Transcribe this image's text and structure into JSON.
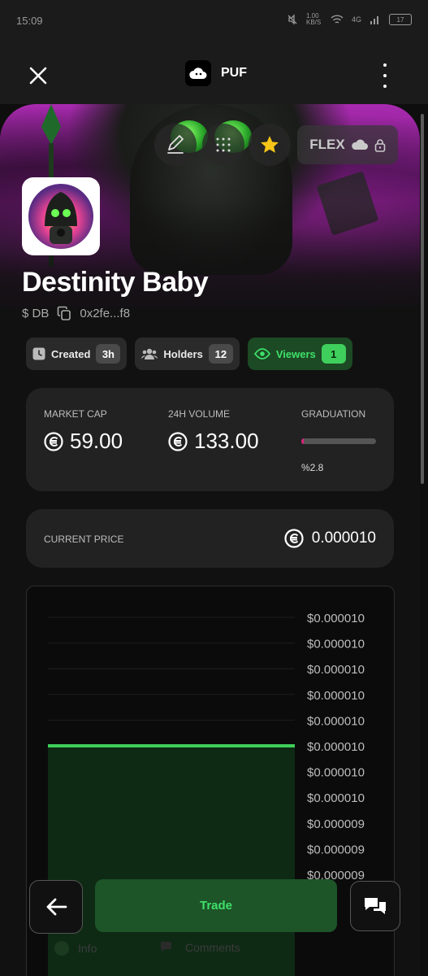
{
  "status": {
    "time": "15:09",
    "net_speed": "1.00 KB/S",
    "network": "4G",
    "battery": "17"
  },
  "appbar": {
    "title": "PUF",
    "close_icon": "close-icon",
    "menu_icon": "more-vertical-icon"
  },
  "banner_actions": {
    "edit_icon": "pencil-icon",
    "grid_icon": "grid-dots-icon",
    "star_icon": "star-icon",
    "flex_label": "FLEX"
  },
  "token": {
    "name": "Destinity Baby",
    "symbol": "$ DB",
    "address": "0x2fe...f8"
  },
  "chips": [
    {
      "label": "Created",
      "value": "3h",
      "icon": "clock-icon"
    },
    {
      "label": "Holders",
      "value": "12",
      "icon": "users-icon"
    },
    {
      "label": "Viewers",
      "value": "1",
      "icon": "eye-icon"
    }
  ],
  "stats": {
    "market_cap_label": "MARKET CAP",
    "market_cap_value": "59.00",
    "volume_label": "24H VOLUME",
    "volume_value": "133.00",
    "graduation_label": "GRADUATION",
    "graduation_pct_text": "%2.8",
    "graduation_fraction": 0.028
  },
  "price": {
    "label": "CURRENT PRICE",
    "value": "0.000010"
  },
  "chart_data": {
    "type": "area",
    "y_tick_labels": [
      "$0.000010",
      "$0.000010",
      "$0.000010",
      "$0.000010",
      "$0.000010",
      "$0.000010",
      "$0.000010",
      "$0.000010",
      "$0.000009",
      "$0.000009",
      "$0.000009"
    ],
    "x": [
      0,
      1
    ],
    "values": [
      1e-05,
      1e-05
    ],
    "series_color": "#3fcf5c",
    "grid": true
  },
  "bottom": {
    "trade_label": "Trade",
    "tab_info": "Info",
    "tab_comments": "Comments"
  },
  "colors": {
    "accent_green": "#3fe06a",
    "graduation_fill": "#e0207a",
    "card_bg": "#222222"
  }
}
